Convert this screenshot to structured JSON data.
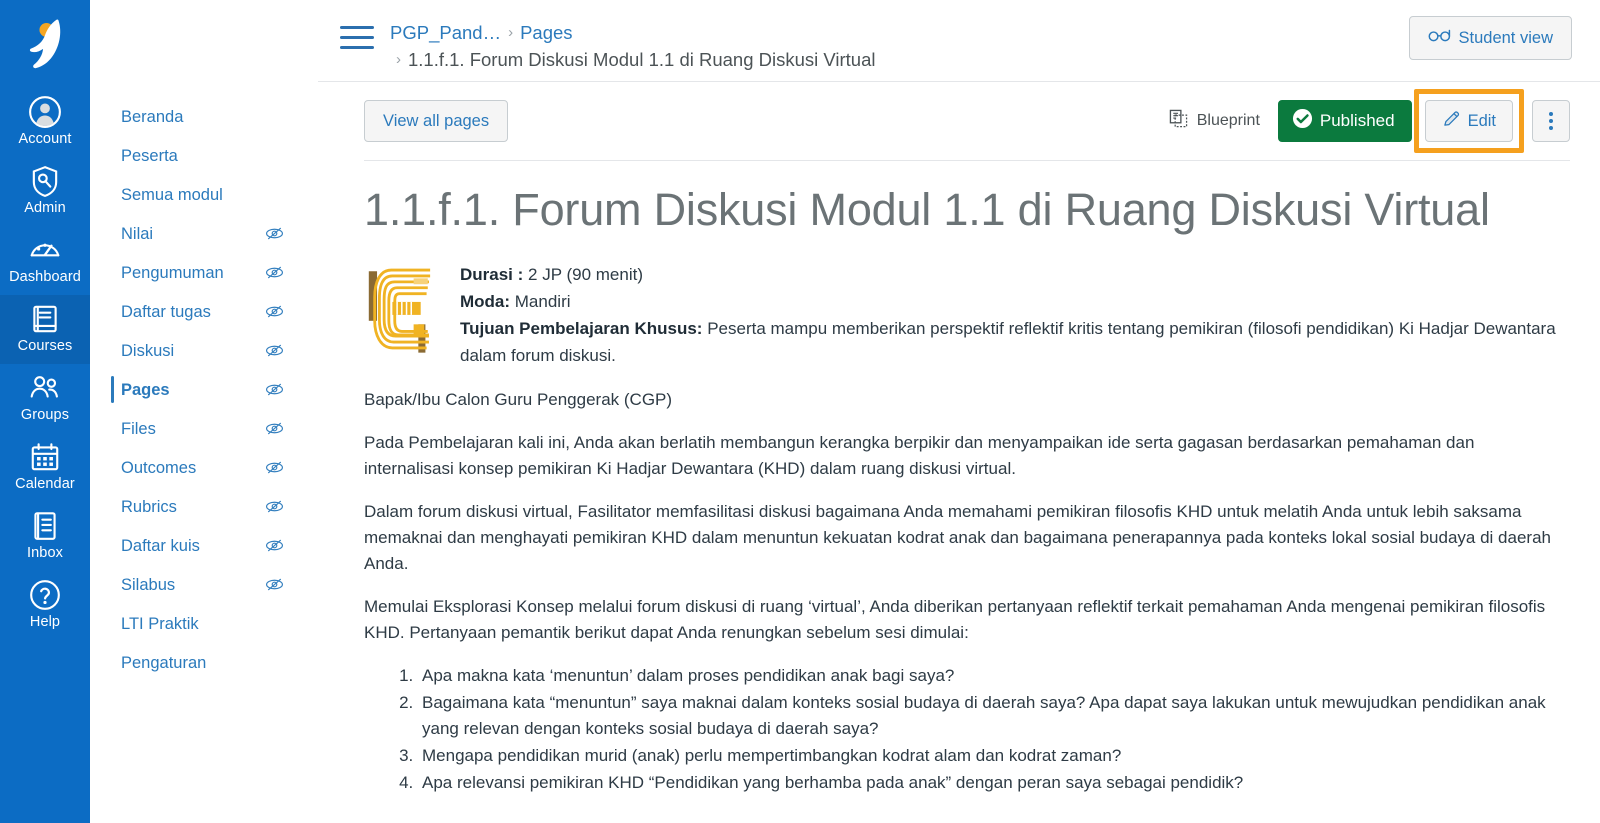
{
  "global_nav": {
    "logo_name": "merdeka-belajar-logo",
    "items": [
      {
        "label": "Account",
        "icon": "user-circle-icon",
        "active": false
      },
      {
        "label": "Admin",
        "icon": "shield-key-icon",
        "active": false
      },
      {
        "label": "Dashboard",
        "icon": "dashboard-gauge-icon",
        "active": false
      },
      {
        "label": "Courses",
        "icon": "book-icon",
        "active": true
      },
      {
        "label": "Groups",
        "icon": "people-icon",
        "active": false
      },
      {
        "label": "Calendar",
        "icon": "calendar-icon",
        "active": false
      },
      {
        "label": "Inbox",
        "icon": "inbox-document-icon",
        "active": false
      },
      {
        "label": "Help",
        "icon": "question-circle-icon",
        "active": false
      }
    ]
  },
  "course_nav": {
    "items": [
      {
        "label": "Beranda",
        "hidden_icon": false,
        "active": false
      },
      {
        "label": "Peserta",
        "hidden_icon": false,
        "active": false
      },
      {
        "label": "Semua modul",
        "hidden_icon": false,
        "active": false
      },
      {
        "label": "Nilai",
        "hidden_icon": true,
        "active": false
      },
      {
        "label": "Pengumuman",
        "hidden_icon": true,
        "active": false
      },
      {
        "label": "Daftar tugas",
        "hidden_icon": true,
        "active": false
      },
      {
        "label": "Diskusi",
        "hidden_icon": true,
        "active": false
      },
      {
        "label": "Pages",
        "hidden_icon": true,
        "active": true
      },
      {
        "label": "Files",
        "hidden_icon": true,
        "active": false
      },
      {
        "label": "Outcomes",
        "hidden_icon": true,
        "active": false
      },
      {
        "label": "Rubrics",
        "hidden_icon": true,
        "active": false
      },
      {
        "label": "Daftar kuis",
        "hidden_icon": true,
        "active": false
      },
      {
        "label": "Silabus",
        "hidden_icon": true,
        "active": false
      },
      {
        "label": "LTI Praktik",
        "hidden_icon": false,
        "active": false
      },
      {
        "label": "Pengaturan",
        "hidden_icon": false,
        "active": false
      }
    ],
    "hidden_icon_name": "eye-slash-icon"
  },
  "topbar": {
    "menu_icon": "hamburger-menu-icon",
    "breadcrumb": {
      "course": "PGP_Pand…",
      "section": "Pages",
      "current": "1.1.f.1. Forum Diskusi Modul 1.1 di Ruang Diskusi Virtual",
      "separator": "›"
    },
    "student_view": {
      "label": "Student view",
      "icon": "eyeglasses-icon"
    }
  },
  "actionbar": {
    "view_all_pages": "View all pages",
    "blueprint": {
      "label": "Blueprint",
      "icon": "blueprint-copy-icon"
    },
    "published": {
      "label": "Published",
      "icon": "check-circle-icon",
      "color": "#0b7a3e"
    },
    "edit": {
      "label": "Edit",
      "icon": "pencil-icon",
      "highlight_color": "#f5a01e"
    },
    "kebab": {
      "name": "more-options",
      "icon": "kebab-menu-icon"
    }
  },
  "page": {
    "title": "1.1.f.1. Forum Diskusi Modul 1.1 di Ruang Diskusi Virtual",
    "logo_name": "stylized-e-logo",
    "meta": {
      "durasi_label": "Durasi :",
      "durasi_value": " 2 JP (90 menit)",
      "moda_label": "Moda:",
      "moda_value": " Mandiri",
      "tujuan_label": "Tujuan Pembelajaran Khusus:",
      "tujuan_value": " Peserta mampu memberikan perspektif reflektif kritis tentang pemikiran (filosofi pendidikan) Ki Hadjar Dewantara dalam forum diskusi."
    },
    "paragraphs": [
      "Bapak/Ibu Calon Guru Penggerak (CGP)",
      "Pada Pembelajaran kali ini, Anda akan berlatih membangun kerangka berpikir dan menyampaikan ide serta gagasan berdasarkan pemahaman dan internalisasi konsep pemikiran Ki Hadjar Dewantara (KHD) dalam ruang diskusi virtual.",
      "Dalam forum diskusi virtual, Fasilitator memfasilitasi diskusi bagaimana Anda memahami pemikiran filosofis KHD untuk melatih Anda untuk lebih saksama memaknai dan menghayati pemikiran KHD dalam menuntun kekuatan kodrat anak dan bagaimana penerapannya pada konteks lokal sosial budaya di daerah Anda.",
      "Memulai Eksplorasi Konsep melalui forum diskusi di ruang ‘virtual’, Anda diberikan pertanyaan reflektif terkait pemahaman Anda mengenai pemikiran filosofis KHD. Pertanyaan pemantik berikut dapat Anda renungkan sebelum sesi dimulai:"
    ],
    "questions": [
      "Apa makna kata ‘menuntun’ dalam proses pendidikan anak bagi saya?",
      "Bagaimana kata “menuntun” saya maknai dalam konteks sosial budaya di daerah saya? Apa dapat saya lakukan untuk mewujudkan pendidikan anak yang relevan dengan konteks sosial budaya di daerah saya?",
      "Mengapa pendidikan murid (anak) perlu mempertimbangkan kodrat alam dan kodrat zaman?",
      "Apa relevansi pemikiran KHD “Pendidikan yang berhamba pada anak” dengan peran saya sebagai pendidik?"
    ]
  },
  "colors": {
    "global_nav_bg": "#0c6cc4",
    "link_blue": "#2b7abc",
    "published_green": "#0b7a3e",
    "highlight_orange": "#f5a01e",
    "logo_gold": "#f0b323"
  }
}
